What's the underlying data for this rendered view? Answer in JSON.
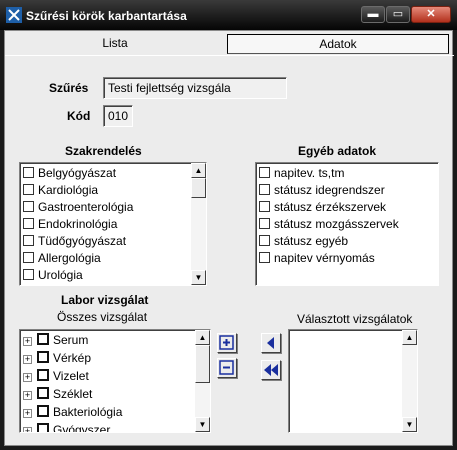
{
  "window": {
    "title": "Szűrési körök karbantartása"
  },
  "titlebar_buttons": {
    "minimize": "▬",
    "maximize": "▭",
    "close": "✕"
  },
  "tabs": [
    {
      "label": "Lista",
      "selected": false
    },
    {
      "label": "Adatok",
      "selected": true
    }
  ],
  "form": {
    "szures_label": "Szűrés",
    "szures_value": "Testi fejlettség vizsgála",
    "kod_label": "Kód",
    "kod_value": "010"
  },
  "szakrendeles": {
    "title": "Szakrendelés",
    "items": [
      "Belgyógyászat",
      "Kardiológia",
      "Gastroenterológia",
      "Endokrinológia",
      "Tüdőgyógyászat",
      "Allergológia",
      "Urológia"
    ]
  },
  "egyeb_adatok": {
    "title": "Egyéb adatok",
    "items": [
      "napitev. ts,tm",
      "státusz idegrendszer",
      "státusz érzékszervek",
      "státusz mozgásszervek",
      "státusz egyéb",
      "napitev vérnyomás"
    ]
  },
  "labor": {
    "title": "Labor vizsgálat",
    "osszes_label": "Összes vizsgálat",
    "valasztott_label": "Választott vizsgálatok",
    "items": [
      "Serum",
      "Vérkép",
      "Vizelet",
      "Széklet",
      "Bakteriológia",
      "Gyógyszer"
    ],
    "expander_symbol": "+"
  },
  "tool_buttons": {
    "add_icon": "plus-box-icon",
    "remove_icon": "minus-box-icon",
    "move_left_icon": "arrow-left-icon",
    "move_all_left_icon": "double-arrow-left-icon"
  },
  "colors": {
    "title_bg": "#0a0a0a",
    "panel_bg": "#ececec",
    "arrow_blue": "#1a2f9e",
    "close_red": "#c0392b"
  }
}
